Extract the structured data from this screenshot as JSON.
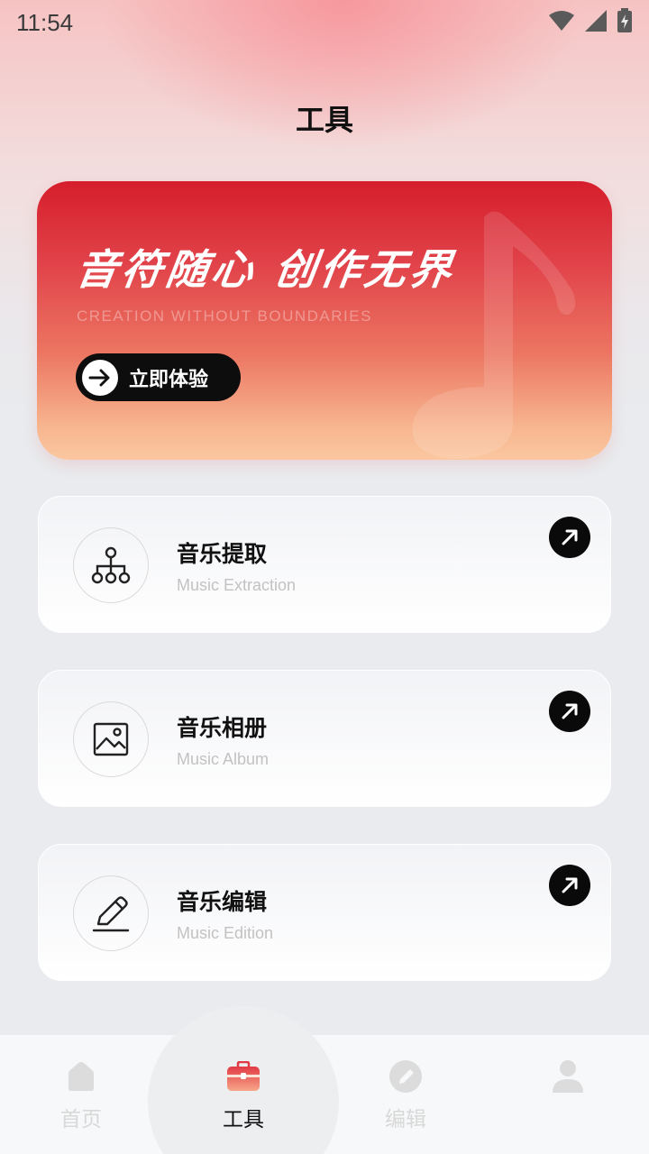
{
  "status_bar": {
    "time": "11:54"
  },
  "header": {
    "title": "工具"
  },
  "banner": {
    "title": "音符随心 创作无界",
    "subtitle": "CREATION WITHOUT BOUNDARIES",
    "button_label": "立即体验"
  },
  "cards": [
    {
      "title": "音乐提取",
      "subtitle": "Music Extraction",
      "icon": "hierarchy-icon"
    },
    {
      "title": "音乐相册",
      "subtitle": "Music Album",
      "icon": "image-icon"
    },
    {
      "title": "音乐编辑",
      "subtitle": "Music Edition",
      "icon": "pencil-icon"
    }
  ],
  "tabbar": {
    "items": [
      {
        "label": "首页",
        "icon": "home-icon",
        "active": false
      },
      {
        "label": "工具",
        "icon": "toolbox-icon",
        "active": true
      },
      {
        "label": "编辑",
        "icon": "edit-icon",
        "active": false
      },
      {
        "label": "",
        "icon": "user-icon",
        "active": false
      }
    ]
  },
  "colors": {
    "accent": "#e03a42",
    "banner_top": "#d61e2c",
    "banner_bottom": "#fbc7a0",
    "tab_active": "#111111",
    "tab_inactive": "#d8d8d8"
  }
}
